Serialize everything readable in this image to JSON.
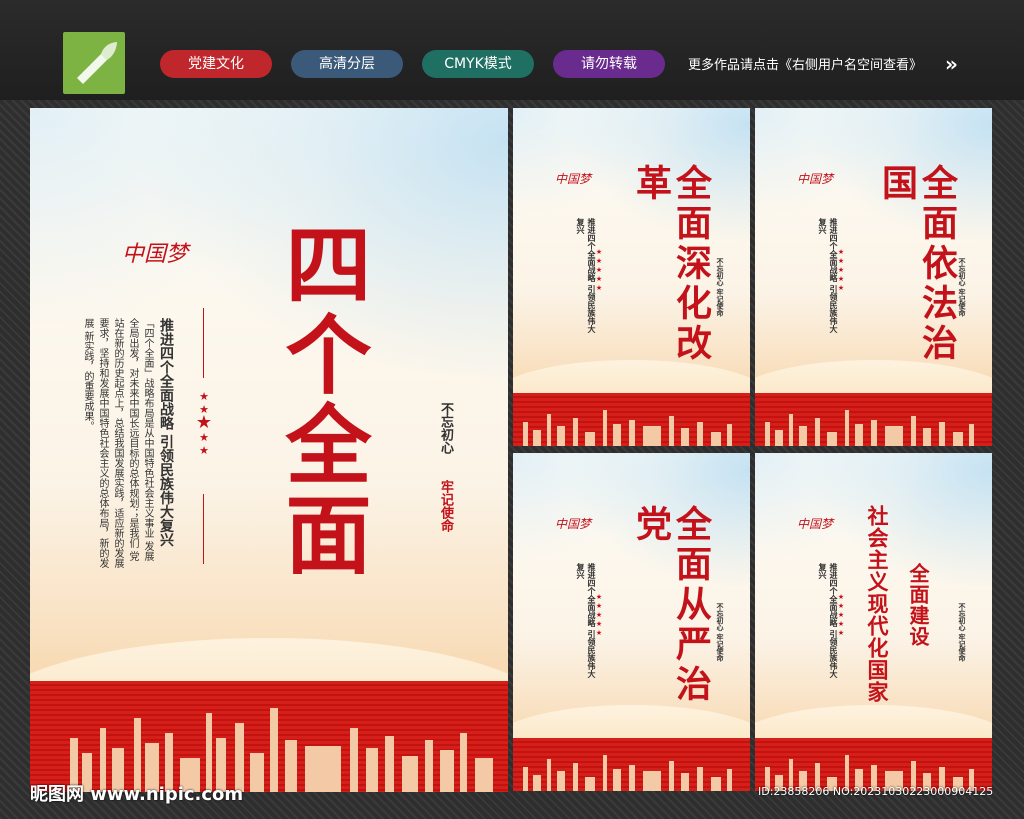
{
  "header": {
    "tags": [
      {
        "label": "党建文化",
        "color": "#c0272d"
      },
      {
        "label": "高清分层",
        "color": "#3b5a7a"
      },
      {
        "label": "CMYK模式",
        "color": "#1f6f63"
      },
      {
        "label": "请勿转载",
        "color": "#6a2b8e"
      }
    ],
    "note": "更多作品请点击《右侧用户名空间查看》",
    "arrow": "»"
  },
  "main_poster": {
    "title": "四个全面",
    "logo_text": "中国梦",
    "headline": "推进四个全面战略 引领民族伟大复兴",
    "body_lines": [
      "「四个全面」战略布局是从中国特色社会主义事业",
      "发展全局出发，对未来中国长远目标的总体规划；是我们",
      "党站在新的历史起点上，总结我国发展实践，适应新的发展",
      "要求，坚持和发展中国特色社会主义的总体布局，新的发展",
      "新实践，的重要成果。"
    ],
    "slogan_a": "不忘初心",
    "slogan_b": "牢记使命"
  },
  "small_posters": [
    {
      "title": "全面深化改革",
      "subtitle": "",
      "headline": "推进四个全面战略 引领民族伟大复兴",
      "slogan": "不忘初心 牢记使命"
    },
    {
      "title": "全面依法治国",
      "subtitle": "",
      "headline": "推进四个全面战略 引领民族伟大复兴",
      "slogan": "不忘初心 牢记使命"
    },
    {
      "title": "全面从严治党",
      "subtitle": "",
      "headline": "推进四个全面战略 引领民族伟大复兴",
      "slogan": "不忘初心 牢记使命"
    },
    {
      "title": "社会主义现代化国家",
      "subtitle": "全面建设",
      "headline": "推进四个全面战略 引领民族伟大复兴",
      "slogan": "不忘初心 牢记使命"
    }
  ],
  "watermark": {
    "left": "昵图网 www.nipic.com",
    "right": "ID:23858206 NO:20231030223000904125"
  }
}
